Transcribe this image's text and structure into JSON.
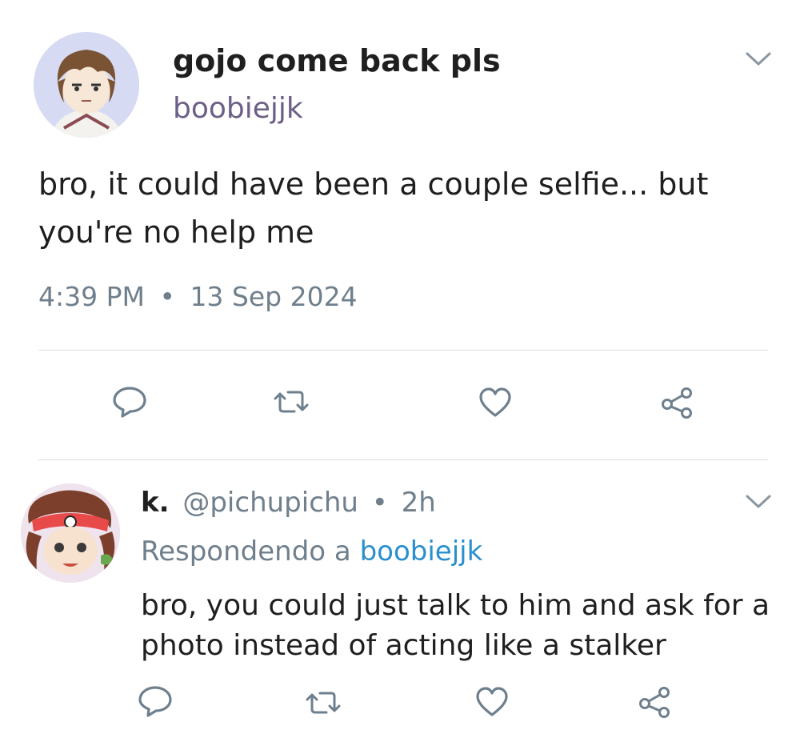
{
  "tweet": {
    "display_name": "gojo come back pls",
    "handle": "boobiejjk",
    "text_line1": "bro, it could have been a couple selfie... but",
    "text_line2": "you're no help me",
    "time": "4:39 PM",
    "separator": "•",
    "date": "13 Sep 2024"
  },
  "reply": {
    "display_name": "k.",
    "handle": "@pichupichu",
    "separator": "•",
    "age": "2h",
    "replying_prefix": "Respondendo a",
    "replying_to": "boobiejjk",
    "text_line1": "bro, you could just talk to him and ask for a",
    "text_line2": "photo instead of acting like a stalker"
  },
  "icons": {
    "tweet_menu": "chevron-down-icon",
    "reply_menu": "chevron-down-icon",
    "comment": "speech-bubble-icon",
    "retweet": "retweet-icon",
    "like": "heart-icon",
    "share": "share-icon"
  },
  "colors": {
    "icon": "#6e7f8d",
    "link": "#2a8fcf",
    "handle": "#6d5f86",
    "divider": "#dcdcdc"
  }
}
